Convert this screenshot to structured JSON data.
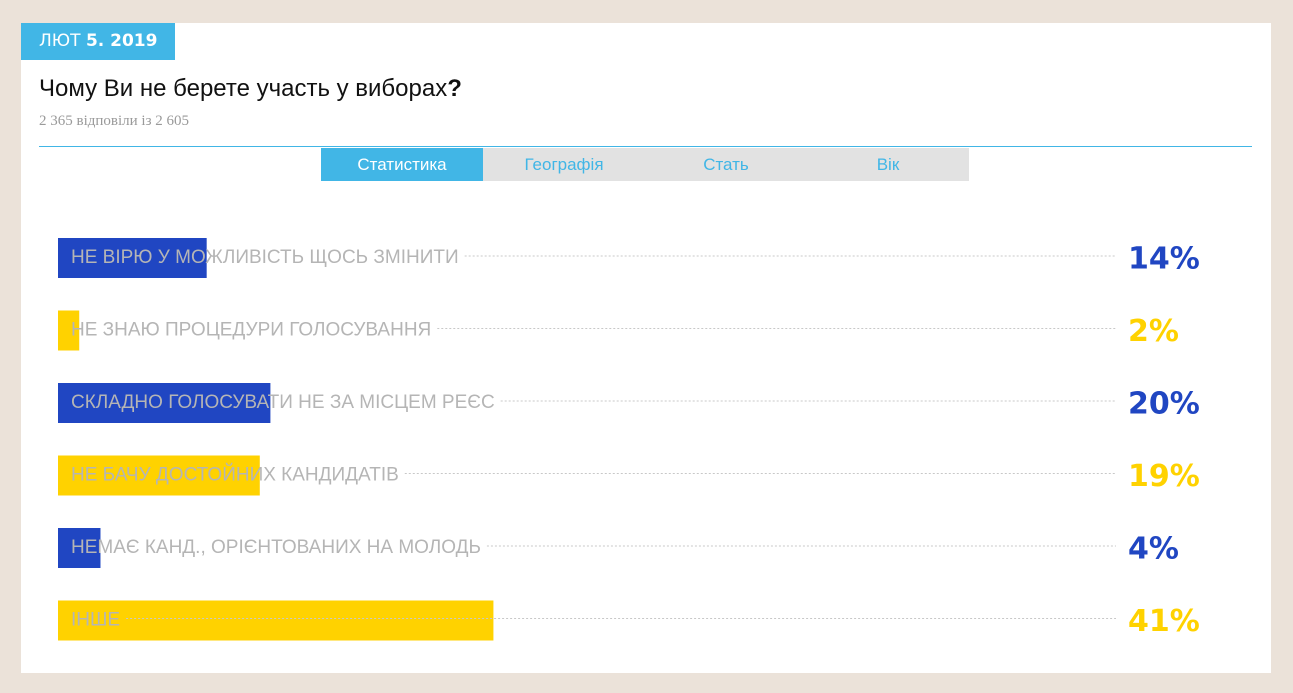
{
  "header": {
    "date_month": "ЛЮТ",
    "date_rest": "5. 2019",
    "question_text": "Чому Ви не берете участь у виборах",
    "question_mark": "?",
    "answers_count": "2 365 відповіли із 2 605"
  },
  "tabs": [
    {
      "label": "Статистика",
      "active": true
    },
    {
      "label": "Географія",
      "active": false
    },
    {
      "label": "Стать",
      "active": false
    },
    {
      "label": "Вік",
      "active": false
    }
  ],
  "colors": {
    "accent": "#41b6e6",
    "blue": "#2046c2",
    "yellow": "#ffd200",
    "label": "#b5b5b5"
  },
  "chart_data": {
    "type": "bar",
    "orientation": "horizontal",
    "categories": [
      "НЕ ВІРЮ У МОЖЛИВІСТЬ ЩОСЬ ЗМІНИТИ",
      "НЕ ЗНАЮ ПРОЦЕДУРИ ГОЛОСУВАННЯ",
      "СКЛАДНО ГОЛОСУВАТИ НЕ ЗА МІСЦЕМ РЕЄС",
      "НЕ БАЧУ ДОСТОЙНИХ КАНДИДАТІВ",
      "НЕМАЄ КАНД., ОРІЄНТОВАНИХ НА МОЛОДЬ",
      "ІНШЕ"
    ],
    "values": [
      14,
      2,
      20,
      19,
      4,
      41
    ],
    "value_labels": [
      "14%",
      "2%",
      "20%",
      "19%",
      "4%",
      "41%"
    ],
    "unit": "%",
    "bar_colors": [
      "blue",
      "yellow",
      "blue",
      "yellow",
      "blue",
      "yellow"
    ],
    "xlim": [
      0,
      100
    ],
    "title": "",
    "xlabel": "",
    "ylabel": ""
  }
}
